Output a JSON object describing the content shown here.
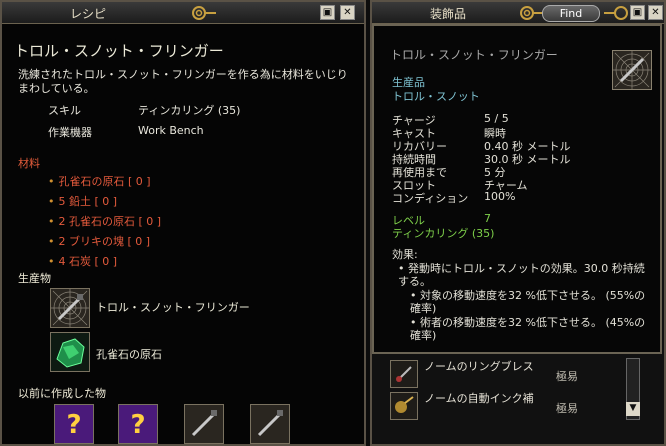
{
  "recipe_window": {
    "title": "レシピ",
    "item_name": "トロル・スノット・フリンガー",
    "description": "洗練されたトロル・スノット・フリンガーを作る為に材料をいじりまわしている。",
    "skill_label": "スキル",
    "skill_value": "ティンカリング (35)",
    "device_label": "作業機器",
    "device_value": "Work Bench",
    "materials_header": "材料",
    "materials": [
      "孔雀石の原石 [ 0 ]",
      "5 鉛土 [ 0 ]",
      "2 孔雀石の原石 [ 0 ]",
      "2 ブリキの塊 [ 0 ]",
      "4 石炭 [ 0 ]"
    ],
    "products_header": "生産物",
    "products": [
      {
        "label": "トロル・スノット・フリンガー",
        "icon": "web-tool-icon"
      },
      {
        "label": "孔雀石の原石",
        "icon": "malachite-icon"
      }
    ],
    "previous_header": "以前に作成した物",
    "previous_icons": [
      "question-icon",
      "question-icon",
      "tool-icon",
      "tool-icon"
    ],
    "buttons": {
      "pin": "▣",
      "close": "✕"
    }
  },
  "jewelry_window": {
    "title": "装飾品",
    "find_label": "Find",
    "buttons": {
      "pin": "▣",
      "close": "✕"
    },
    "list": [
      {
        "name": "ノームのリングブレス",
        "difficulty": "極易"
      },
      {
        "name": "ノームの自動インク補",
        "difficulty": "極易"
      }
    ]
  },
  "tooltip": {
    "name": "トロル・スノット・フリンガー",
    "category": "生産品",
    "subcategory": "トロル・スノット",
    "stats": [
      {
        "label": "チャージ",
        "value": "5 / 5"
      },
      {
        "label": "キャスト",
        "value": "瞬時"
      },
      {
        "label": "リカバリー",
        "value": "0.40 秒 メートル"
      },
      {
        "label": "持続時間",
        "value": "30.0 秒 メートル"
      },
      {
        "label": "再使用まで",
        "value": "5 分"
      },
      {
        "label": "スロット",
        "value": "チャーム"
      },
      {
        "label": "コンディション",
        "value": "100%"
      }
    ],
    "level_label": "レベル",
    "level_value": "7",
    "skill_req": "ティンカリング (35)",
    "effect_header": "効果:",
    "effect_main": "発動時にトロル・スノットの効果。30.0 秒持続する。",
    "effect_sub1": "対象の移動速度を32 %低下させる。 (55%の確率)",
    "effect_sub2": "術者の移動速度を32 %低下させる。 (45%の確率)"
  },
  "colors": {
    "material_red": "#e45a3c",
    "cyan": "#7fc3d2",
    "green": "#7ed04a",
    "border_gold": "#6b624f"
  }
}
